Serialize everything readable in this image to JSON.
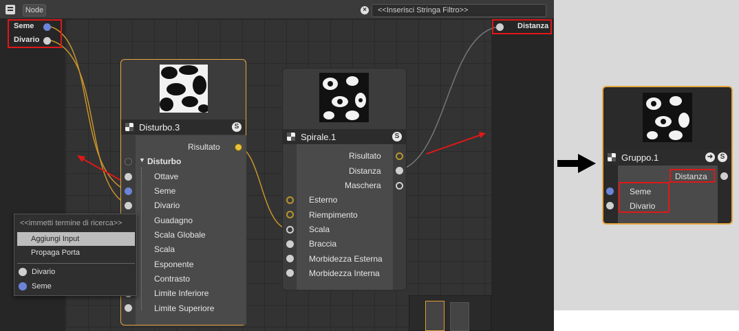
{
  "toolbar": {
    "menu_label": "Node",
    "filter_placeholder": "<<Inserisci Stringa Filtro>>"
  },
  "left_ports": [
    {
      "label": "Seme",
      "color": "#6c84d8"
    },
    {
      "label": "Divario",
      "color": "#cfcfcf"
    }
  ],
  "right_port": {
    "label": "Distanza"
  },
  "disturbo_node": {
    "title": "Disturbo.3",
    "badge": "S",
    "output": "Risultato",
    "group": "Disturbo",
    "inputs": [
      "Ottave",
      "Seme",
      "Divario",
      "Guadagno",
      "Scala Globale",
      "Scala",
      "Esponente",
      "Contrasto",
      "Limite Inferiore",
      "Limite Superiore"
    ]
  },
  "spirale_node": {
    "title": "Spirale.1",
    "badge": "S",
    "outputs": [
      "Risultato",
      "Distanza",
      "Maschera"
    ],
    "inputs": [
      "Esterno",
      "Riempimento",
      "Scala",
      "Braccia",
      "Morbidezza Esterna",
      "Morbidezza Interna"
    ]
  },
  "context_menu": {
    "search_placeholder": "<<immetti termine di ricerca>>",
    "items": [
      "Aggiungi Input",
      "Propaga Porta"
    ],
    "ports": [
      {
        "label": "Divario",
        "color": "#cfcfcf"
      },
      {
        "label": "Seme",
        "color": "#6c84d8"
      }
    ]
  },
  "gruppo_node": {
    "title": "Gruppo.1",
    "badge": "S",
    "output": "Distanza",
    "inputs": [
      "Seme",
      "Divario"
    ]
  },
  "colors": {
    "accent": "#e8a840",
    "highlight_box": "#e01818",
    "wire": "#c8942a"
  }
}
